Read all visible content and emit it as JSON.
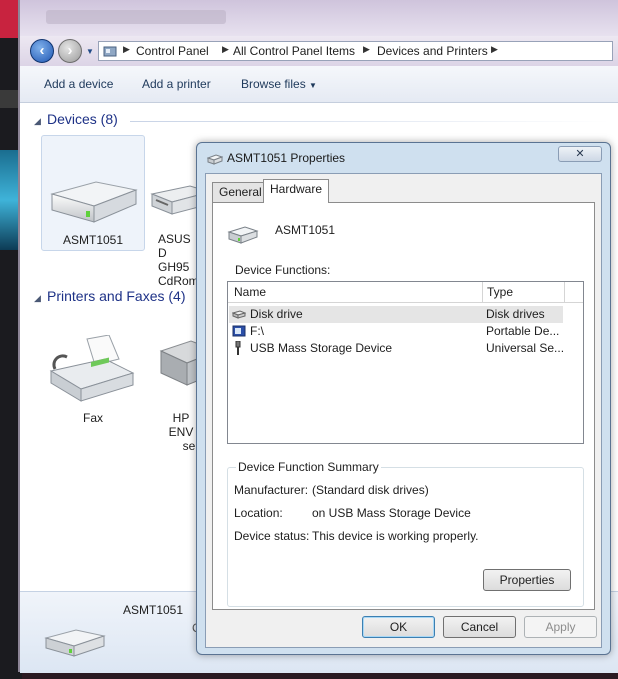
{
  "window": {
    "title_blurred": "www.fuzzfriendly.net/journal/..."
  },
  "breadcrumb": {
    "items": [
      "Control Panel",
      "All Control Panel Items",
      "Devices and Printers"
    ]
  },
  "toolbar": {
    "add_device": "Add a device",
    "add_printer": "Add a printer",
    "browse_files": "Browse files"
  },
  "devices_group": {
    "header": "Devices (8)",
    "items": [
      {
        "label": "ASMT1051"
      },
      {
        "label_line1": "ASUS D",
        "label_line2": "GH95",
        "label_line3": "CdRom"
      }
    ]
  },
  "printers_group": {
    "header": "Printers and Faxes (4)",
    "items": [
      {
        "label": "Fax"
      },
      {
        "label_line1": "HP ENV",
        "label_line2": "ser"
      }
    ]
  },
  "details_pane": {
    "device_name": "ASMT1051",
    "partial": "C"
  },
  "dialog": {
    "title": "ASMT1051 Properties",
    "close_glyph": "✕",
    "tabs": [
      "General",
      "Hardware"
    ],
    "device_name": "ASMT1051",
    "functions_label": "Device Functions:",
    "columns": [
      "Name",
      "Type"
    ],
    "rows": [
      {
        "name": "Disk drive",
        "type": "Disk drives",
        "icon": "disk-drive-icon"
      },
      {
        "name": "F:\\",
        "type": "Portable De...",
        "icon": "portable-device-icon"
      },
      {
        "name": "USB Mass Storage Device",
        "type": "Universal Se...",
        "icon": "usb-icon"
      }
    ],
    "summary_title": "Device Function Summary",
    "summary": {
      "manufacturer_label": "Manufacturer:",
      "manufacturer": "(Standard disk drives)",
      "location_label": "Location:",
      "location": "on USB Mass Storage Device",
      "status_label": "Device status:",
      "status": "This device is working properly."
    },
    "properties_button": "Properties",
    "ok_button": "OK",
    "cancel_button": "Cancel",
    "apply_button": "Apply"
  },
  "colors": {
    "group_header": "#1e3287",
    "toolbar_text": "#1e395b",
    "selection": "#e5e5e5",
    "dialog_frame": "#cfe0ef"
  }
}
